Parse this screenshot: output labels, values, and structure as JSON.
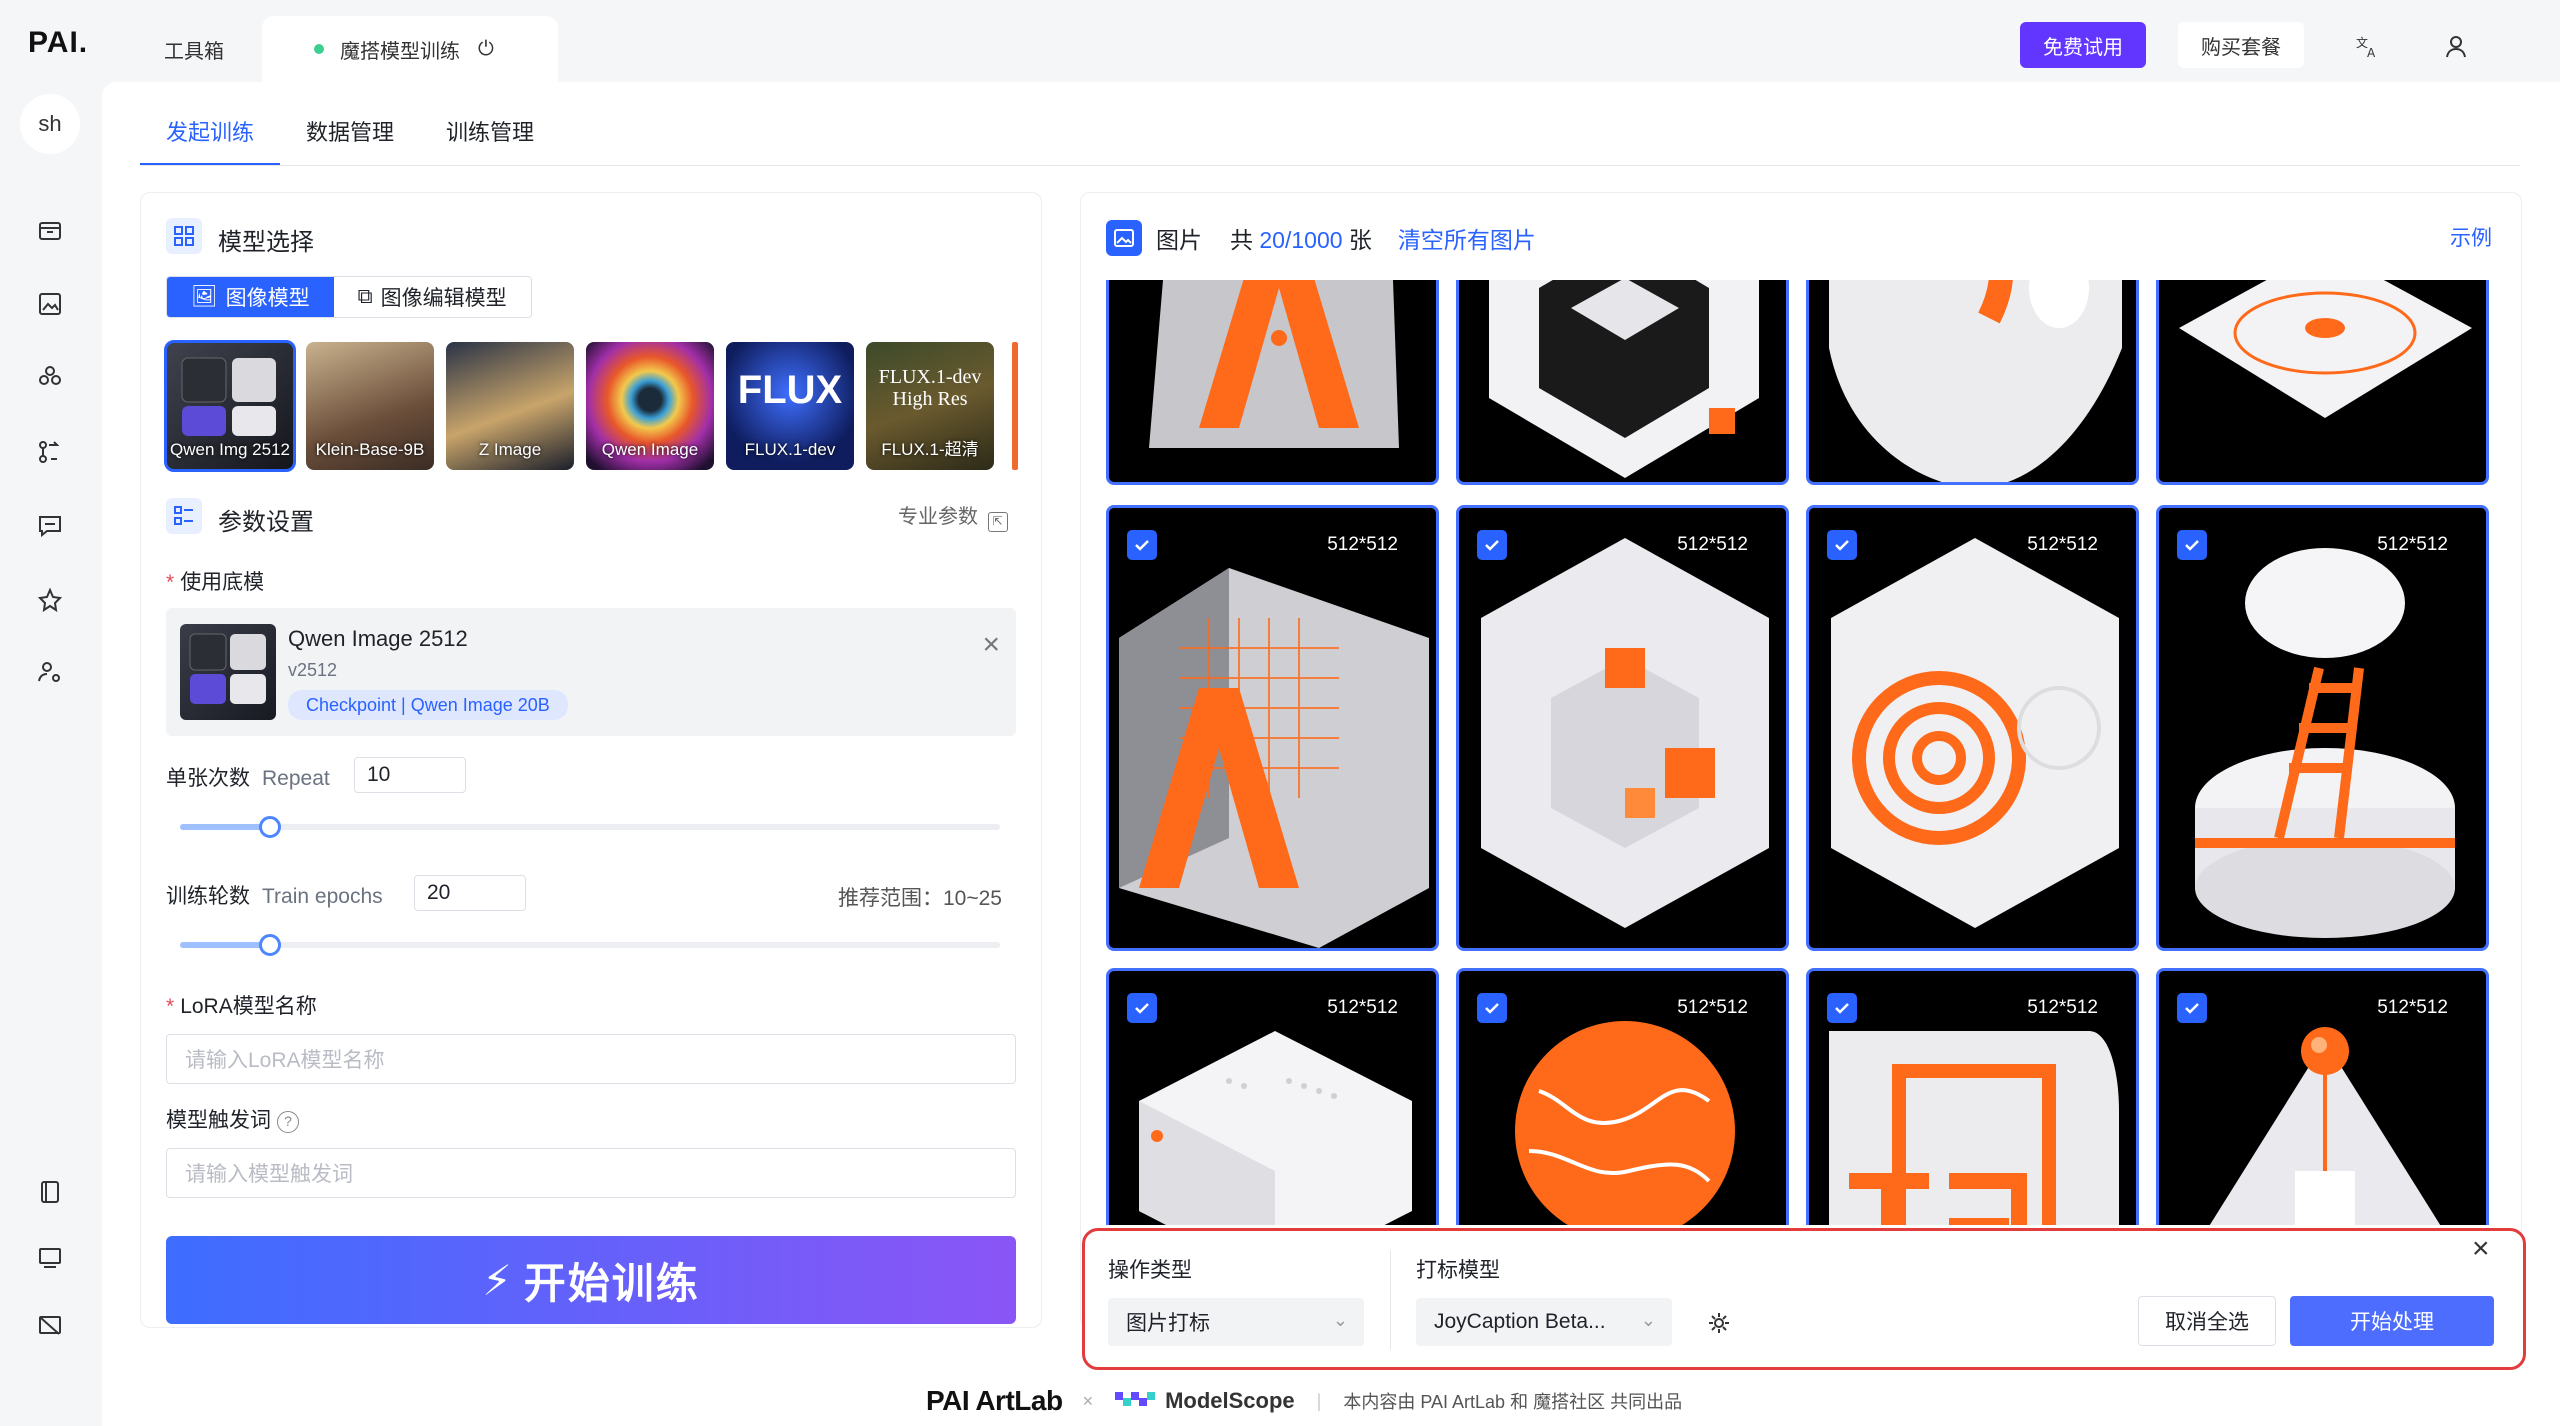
{
  "app": {
    "logo": "PAI."
  },
  "topbar": {
    "tabs": [
      {
        "label": "工具箱"
      },
      {
        "label": "魔搭模型训练"
      }
    ],
    "free_trial": "免费试用",
    "buy_plan": "购买套餐"
  },
  "user": {
    "avatar_text": "sh"
  },
  "subtabs": [
    {
      "label": "发起训练",
      "active": true
    },
    {
      "label": "数据管理",
      "active": false
    },
    {
      "label": "训练管理",
      "active": false
    }
  ],
  "model_select": {
    "title": "模型选择",
    "segments": [
      {
        "label": "图像模型",
        "active": true
      },
      {
        "label": "图像编辑模型",
        "active": false
      }
    ],
    "models": [
      {
        "caption": "Qwen Img 2512",
        "selected": true
      },
      {
        "caption": "Klein-Base-9B",
        "selected": false
      },
      {
        "caption": "Z Image",
        "selected": false
      },
      {
        "caption": "Qwen Image",
        "selected": false
      },
      {
        "caption": "FLUX.1-dev",
        "big": "FLUX",
        "selected": false
      },
      {
        "caption": "FLUX.1-超清",
        "big": "FLUX.1-dev High Res",
        "selected": false
      }
    ]
  },
  "params": {
    "title": "参数设置",
    "pro_params": "专业参数",
    "base_model_label": "使用底模",
    "base_model": {
      "name": "Qwen Image 2512",
      "version": "v2512",
      "tag": "Checkpoint | Qwen Image 20B"
    },
    "repeat_label": "单张次数",
    "repeat_en": "Repeat",
    "repeat_value": "10",
    "repeat_slider": 0.11,
    "epochs_label": "训练轮数",
    "epochs_en": "Train epochs",
    "epochs_value": "20",
    "epochs_slider": 0.11,
    "recommend_range": "推荐范围：10~25",
    "lora_name_label": "LoRA模型名称",
    "lora_name_placeholder": "请输入LoRA模型名称",
    "trigger_label": "模型触发词",
    "trigger_placeholder": "请输入模型触发词",
    "train_button": "开始训练"
  },
  "images": {
    "title": "图片",
    "count_prefix": "共",
    "count": "20/1000",
    "count_suffix": "张",
    "clear_all": "清空所有图片",
    "example": "示例",
    "tiles": [
      {
        "res": "512*512"
      },
      {
        "res": "512*512"
      },
      {
        "res": "512*512"
      },
      {
        "res": "512*512"
      },
      {
        "res": "512*512"
      },
      {
        "res": "512*512"
      },
      {
        "res": "512*512"
      },
      {
        "res": "512*512"
      }
    ]
  },
  "action_bar": {
    "op_type_label": "操作类型",
    "op_type_value": "图片打标",
    "tag_model_label": "打标模型",
    "tag_model_value": "JoyCaption Beta...",
    "cancel_select": "取消全选",
    "start_process": "开始处理"
  },
  "footer": {
    "brand": "PAI ArtLab",
    "partner": "ModelScope",
    "note": "本内容由 PAI ArtLab 和 魔搭社区 共同出品"
  },
  "colors": {
    "accent": "#2962ff",
    "brand_purple": "#6236ff",
    "orange": "#ff6a1a",
    "highlight_red": "#e23c3c"
  }
}
